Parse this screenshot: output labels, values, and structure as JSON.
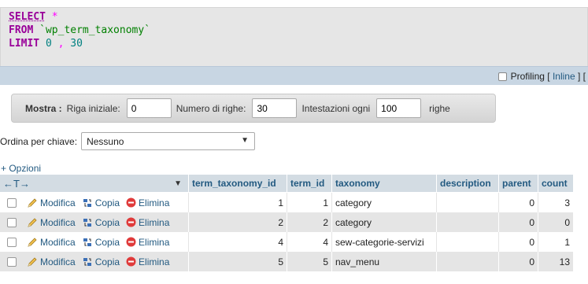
{
  "sql": {
    "select_kw": "SELECT",
    "star": "*",
    "from_kw": "FROM",
    "table": "`wp_term_taxonomy`",
    "limit_kw": "LIMIT",
    "limit_start": "0",
    "comma": ",",
    "limit_count": "30"
  },
  "profiling": {
    "label": "Profiling",
    "bracket_open": "[",
    "inline_link": "Inline",
    "bracket_close": "] ["
  },
  "navbar": {
    "show_label": "Mostra :",
    "start_row_label": "Riga iniziale:",
    "start_row_value": "0",
    "num_rows_label": "Numero di righe:",
    "num_rows_value": "30",
    "headers_every_label": "Intestazioni ogni",
    "headers_every_value": "100",
    "rows_label": "righe"
  },
  "sort": {
    "label": "Ordina per chiave:",
    "selected": "Nessuno"
  },
  "options_link": "+ Opzioni",
  "table": {
    "resize_arrows": "←T→",
    "columns": [
      "term_taxonomy_id",
      "term_id",
      "taxonomy",
      "description",
      "parent",
      "count"
    ],
    "action_labels": {
      "edit": "Modifica",
      "copy": "Copia",
      "delete": "Elimina"
    },
    "rows": [
      {
        "term_taxonomy_id": "1",
        "term_id": "1",
        "taxonomy": "category",
        "description": "",
        "parent": "0",
        "count": "3"
      },
      {
        "term_taxonomy_id": "2",
        "term_id": "2",
        "taxonomy": "category",
        "description": "",
        "parent": "0",
        "count": "0"
      },
      {
        "term_taxonomy_id": "4",
        "term_id": "4",
        "taxonomy": "sew-categorie-servizi",
        "description": "",
        "parent": "0",
        "count": "1"
      },
      {
        "term_taxonomy_id": "5",
        "term_id": "5",
        "taxonomy": "nav_menu",
        "description": "",
        "parent": "0",
        "count": "13"
      }
    ]
  },
  "colors": {
    "keyword": "#990099",
    "identifier": "#008000",
    "number": "#008080",
    "link": "#235a81",
    "header_bg": "#d3dce3",
    "row_alt": "#e5e5e5",
    "delete_icon": "#e03b3b"
  }
}
